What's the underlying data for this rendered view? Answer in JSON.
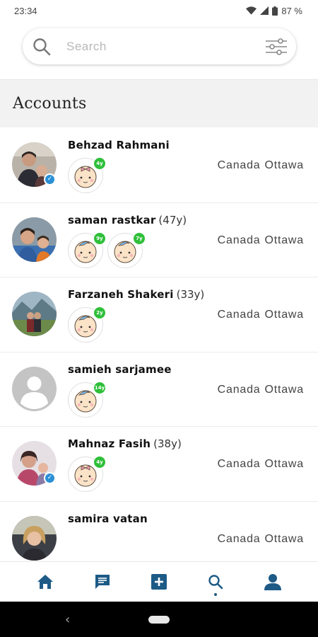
{
  "status_bar": {
    "time": "23:34",
    "battery": "87 %",
    "icons": [
      "wifi-icon",
      "signal-icon",
      "battery-icon"
    ]
  },
  "search": {
    "placeholder": "Search",
    "value": "",
    "icon": "search-icon",
    "filter_icon": "filter-sliders-icon"
  },
  "section": {
    "title": "Accounts"
  },
  "accounts": [
    {
      "name": "Behzad Rahmani",
      "age": "",
      "verified": true,
      "country": "Canada",
      "city": "Ottawa",
      "children": [
        {
          "badge": "4y",
          "type": "girl"
        }
      ]
    },
    {
      "name": "saman rastkar",
      "age": "(47y)",
      "verified": false,
      "country": "Canada",
      "city": "Ottawa",
      "children": [
        {
          "badge": "9y",
          "type": "boy"
        },
        {
          "badge": "7y",
          "type": "boy"
        }
      ]
    },
    {
      "name": "Farzaneh Shakeri",
      "age": "(33y)",
      "verified": false,
      "country": "Canada",
      "city": "Ottawa",
      "children": [
        {
          "badge": "2y",
          "type": "boy"
        }
      ]
    },
    {
      "name": "samieh sarjamee",
      "age": "",
      "verified": false,
      "country": "Canada",
      "city": "Ottawa",
      "children": [
        {
          "badge": "14y",
          "type": "boy"
        }
      ]
    },
    {
      "name": "Mahnaz Fasih",
      "age": "(38y)",
      "verified": true,
      "country": "Canada",
      "city": "Ottawa",
      "children": [
        {
          "badge": "4y",
          "type": "girl"
        }
      ]
    },
    {
      "name": "samira vatan",
      "age": "",
      "verified": false,
      "country": "Canada",
      "city": "Ottawa",
      "children": []
    }
  ],
  "bottom_nav": [
    {
      "icon": "home-icon",
      "active": false
    },
    {
      "icon": "chat-icon",
      "active": false
    },
    {
      "icon": "add-post-icon",
      "active": false
    },
    {
      "icon": "search-icon",
      "active": true
    },
    {
      "icon": "profile-icon",
      "active": false
    }
  ],
  "colors": {
    "accent": "#1d5a86",
    "badge_green": "#2fbf3a",
    "verified_blue": "#2a8fd6",
    "header_bg": "#f2f2f2"
  }
}
